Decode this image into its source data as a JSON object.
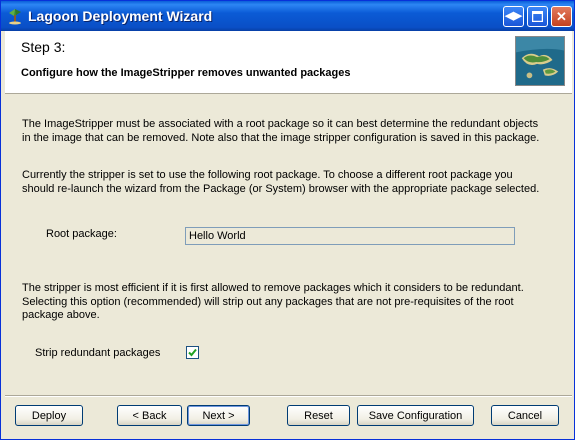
{
  "window": {
    "title": "Lagoon Deployment Wizard"
  },
  "header": {
    "step": "Step 3:",
    "subtitle": "Configure how the ImageStripper removes unwanted packages"
  },
  "body": {
    "para1": "The ImageStripper must be associated with a root package so it can best determine the redundant objects in the image that can be removed. Note also that the image stripper configuration is saved in this package.",
    "para2": "Currently the stripper is set to use the following root package. To choose a different root package you should re-launch the wizard from the Package (or System) browser with the appropriate package selected.",
    "root_label": "Root package:",
    "root_value": "Hello World",
    "para3": "The stripper is most efficient if it is first allowed to remove packages which it considers to be redundant. Selecting this option (recommended) will strip out any packages that are not pre-requisites of the root package above.",
    "strip_label": "Strip redundant packages",
    "strip_checked": true
  },
  "buttons": {
    "deploy": "Deploy",
    "back": "< Back",
    "next": "Next >",
    "reset": "Reset",
    "save": "Save Configuration",
    "cancel": "Cancel"
  }
}
